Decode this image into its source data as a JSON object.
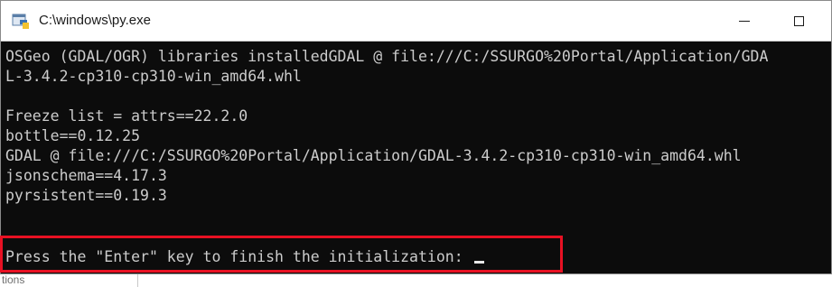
{
  "window": {
    "title": "C:\\windows\\py.exe",
    "icon": "python-launcher-icon",
    "controls": {
      "minimize": "minimize-icon",
      "maximize": "maximize-icon"
    }
  },
  "console": {
    "lines": [
      "OSGeo (GDAL/OGR) libraries installedGDAL @ file:///C:/SSURGO%20Portal/Application/GDA",
      "L-3.4.2-cp310-cp310-win_amd64.whl",
      "Freeze list = attrs==22.2.0",
      "bottle==0.12.25",
      "GDAL @ file:///C:/SSURGO%20Portal/Application/GDAL-3.4.2-cp310-cp310-win_amd64.whl",
      "jsonschema==4.17.3",
      "pyrsistent==0.19.3"
    ],
    "prompt": "Press the \"Enter\" key to finish the initialization: "
  },
  "colors": {
    "console_bg": "#0c0c0c",
    "console_text": "#cccccc",
    "highlight": "#e81123"
  },
  "below": {
    "text": "tions"
  }
}
